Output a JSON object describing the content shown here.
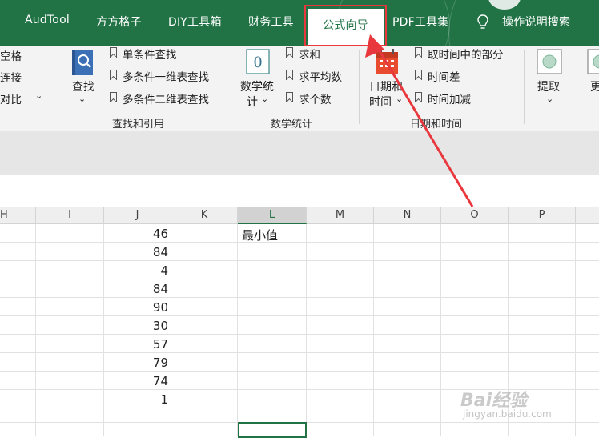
{
  "tabs": [
    {
      "label": "AudTool"
    },
    {
      "label": "方方格子"
    },
    {
      "label": "DIY工具箱"
    },
    {
      "label": "财务工具"
    },
    {
      "label": "公式向导"
    },
    {
      "label": "PDF工具集"
    },
    {
      "label": "操作说明搜索"
    }
  ],
  "ribbon": {
    "left_partial": [
      "空格",
      "连接",
      "对比"
    ],
    "lookup": {
      "big_button": "查找",
      "items": [
        "单条件查找",
        "多条件一维表查找",
        "多条件二维表查找"
      ],
      "group_label": "查找和引用"
    },
    "math": {
      "big_button_line1": "数学统",
      "big_button_line2": "计",
      "items": [
        "求和",
        "求平均数",
        "求个数"
      ],
      "group_label": "数学统计"
    },
    "datetime": {
      "big_button_line1": "日期和",
      "big_button_line2": "时间",
      "items": [
        "取时间中的部分",
        "时间差",
        "时间加减"
      ],
      "group_label": "日期和时间"
    },
    "extract": {
      "label": "提取"
    },
    "more_partial": "更"
  },
  "columns": [
    "H",
    "I",
    "J",
    "K",
    "L",
    "M",
    "N",
    "O",
    "P"
  ],
  "cells": {
    "j_values": [
      "46",
      "84",
      "4",
      "84",
      "90",
      "30",
      "57",
      "79",
      "74",
      "1"
    ],
    "l1": "最小值"
  },
  "watermark": {
    "main": "Bai经验",
    "sub": "jingyan.baidu.com"
  },
  "colors": {
    "ribbon_green": "#217346",
    "highlight_red": "#e8383d"
  }
}
